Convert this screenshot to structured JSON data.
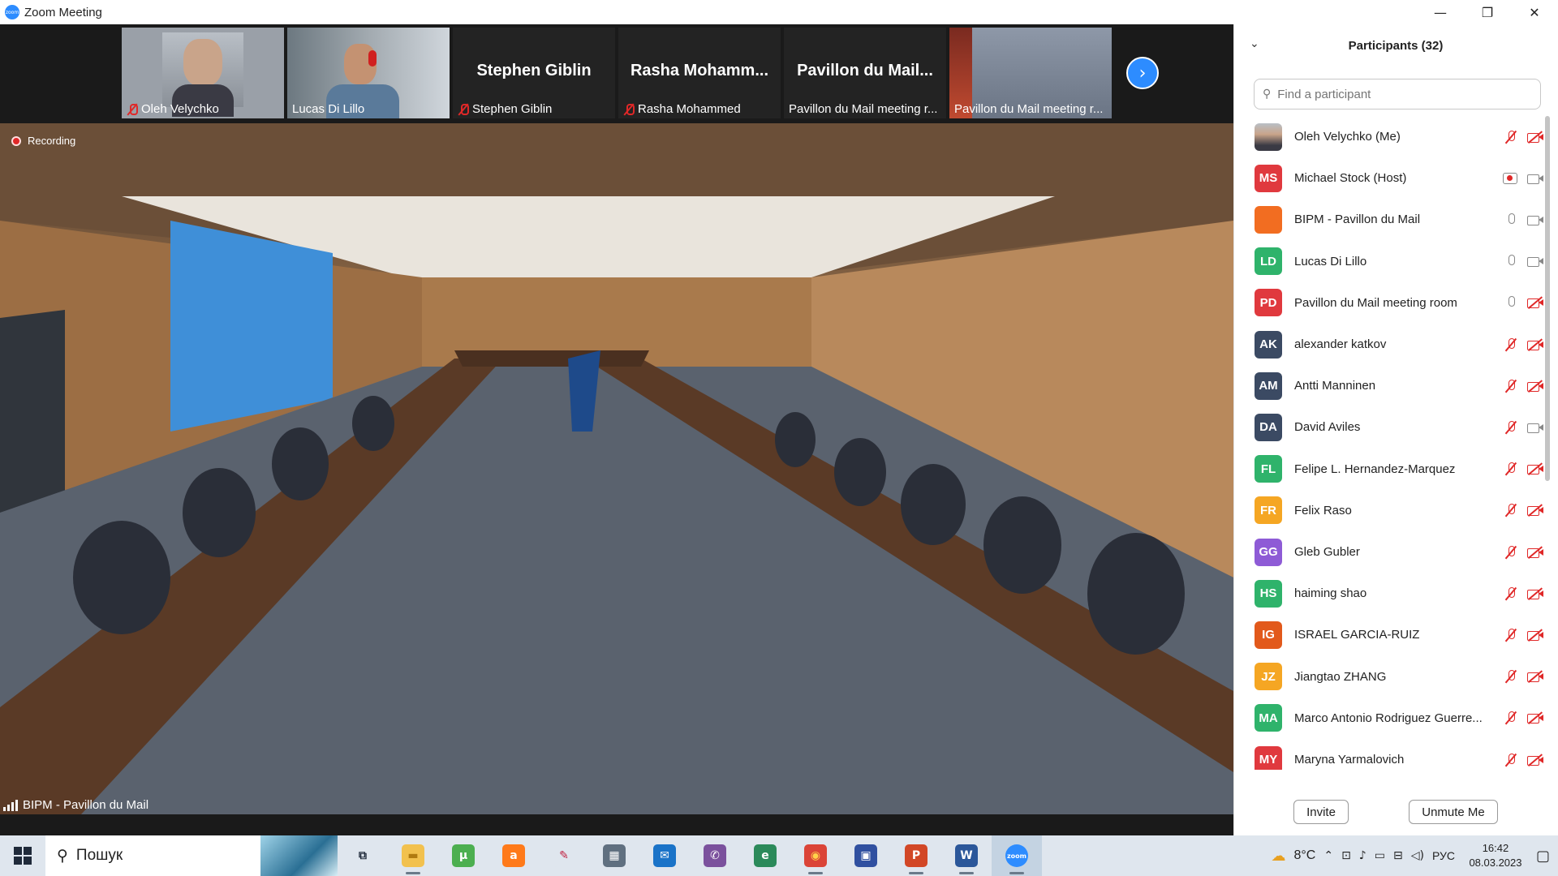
{
  "window": {
    "title": "Zoom Meeting",
    "logo_text": "zoom",
    "minimize": "—",
    "restore": "❐",
    "close": "✕"
  },
  "thumbnails": [
    {
      "name": "Oleh Velychko",
      "muted": true,
      "video": true
    },
    {
      "name": "Lucas Di Lillo",
      "muted": false,
      "video": true
    },
    {
      "name": "Stephen Giblin",
      "display": "Stephen Giblin",
      "muted": true,
      "video": false
    },
    {
      "name": "Rasha Mohammed",
      "display": "Rasha Mohamm...",
      "muted": true,
      "video": false
    },
    {
      "name": "Pavillon du Mail meeting r...",
      "display": "Pavillon du Mail...",
      "muted": false,
      "video": false
    },
    {
      "name": "Pavillon du Mail meeting r...",
      "muted": false,
      "video": true
    }
  ],
  "main_video": {
    "recording_label": "Recording",
    "speaker": "BIPM - Pavillon du Mail"
  },
  "panel": {
    "title": "Participants (32)",
    "search_placeholder": "Find a participant",
    "invite": "Invite",
    "unmute": "Unmute Me",
    "participants": [
      {
        "initials": "",
        "name": "Oleh Velychko (Me)",
        "color": "#7a6a5a",
        "photo": true,
        "mic": "off",
        "cam": "off"
      },
      {
        "initials": "MS",
        "name": "Michael Stock (Host)",
        "color": "#e0393e",
        "mic": "rec",
        "cam": "on"
      },
      {
        "initials": "",
        "name": "BIPM - Pavillon du Mail",
        "color": "#f26d21",
        "room": true,
        "mic": "on",
        "cam": "on"
      },
      {
        "initials": "LD",
        "name": "Lucas Di Lillo",
        "color": "#2fb36b",
        "mic": "on",
        "cam": "on"
      },
      {
        "initials": "PD",
        "name": "Pavillon du Mail meeting room",
        "color": "#e0393e",
        "mic": "on",
        "cam": "off"
      },
      {
        "initials": "AK",
        "name": "alexander katkov",
        "color": "#3b4a63",
        "mic": "off",
        "cam": "off"
      },
      {
        "initials": "AM",
        "name": "Antti Manninen",
        "color": "#3b4a63",
        "mic": "off",
        "cam": "off"
      },
      {
        "initials": "DA",
        "name": "David Aviles",
        "color": "#3b4a63",
        "mic": "off",
        "cam": "on"
      },
      {
        "initials": "FL",
        "name": "Felipe L. Hernandez-Marquez",
        "color": "#2fb36b",
        "mic": "off",
        "cam": "off"
      },
      {
        "initials": "FR",
        "name": "Felix Raso",
        "color": "#f5a623",
        "mic": "off",
        "cam": "off"
      },
      {
        "initials": "GG",
        "name": "Gleb Gubler",
        "color": "#8e5bd6",
        "mic": "off",
        "cam": "off"
      },
      {
        "initials": "HS",
        "name": "haiming shao",
        "color": "#2fb36b",
        "mic": "off",
        "cam": "off"
      },
      {
        "initials": "IG",
        "name": "ISRAEL GARCIA-RUIZ",
        "color": "#e2591b",
        "mic": "off",
        "cam": "off"
      },
      {
        "initials": "JZ",
        "name": "Jiangtao ZHANG",
        "color": "#f5a623",
        "mic": "off",
        "cam": "off"
      },
      {
        "initials": "MA",
        "name": "Marco Antonio Rodriguez Guerre...",
        "color": "#2fb36b",
        "mic": "off",
        "cam": "off"
      },
      {
        "initials": "MY",
        "name": "Maryna Yarmalovich",
        "color": "#e0393e",
        "mic": "off",
        "cam": "off"
      }
    ]
  },
  "taskbar": {
    "search_text": "Пошук",
    "weather": "8°C",
    "lang": "РУС",
    "time": "16:42",
    "date": "08.03.2023",
    "apps": [
      {
        "name": "task-view",
        "color": "#dfe6ee",
        "glyph": "⧉",
        "fg": "#1f2a3a"
      },
      {
        "name": "file-explorer",
        "color": "#f2c14e",
        "glyph": "▬",
        "fg": "#b07a10"
      },
      {
        "name": "utorrent",
        "color": "#4caf50",
        "glyph": "μ",
        "fg": "#fff"
      },
      {
        "name": "avast",
        "color": "#ff7a1a",
        "glyph": "a",
        "fg": "#fff"
      },
      {
        "name": "paint",
        "color": "#dfe6ee",
        "glyph": "✎",
        "fg": "#c02040"
      },
      {
        "name": "calculator",
        "color": "#607080",
        "glyph": "▦",
        "fg": "#fff"
      },
      {
        "name": "mail",
        "color": "#1a73c8",
        "glyph": "✉",
        "fg": "#fff"
      },
      {
        "name": "viber",
        "color": "#7b519d",
        "glyph": "✆",
        "fg": "#fff"
      },
      {
        "name": "edge",
        "color": "#2b8a5a",
        "glyph": "e",
        "fg": "#fff"
      },
      {
        "name": "chrome",
        "color": "#db4437",
        "glyph": "◉",
        "fg": "#ffd24a"
      },
      {
        "name": "save-disk",
        "color": "#3050a0",
        "glyph": "▣",
        "fg": "#fff"
      },
      {
        "name": "powerpoint",
        "color": "#d24726",
        "glyph": "P",
        "fg": "#fff"
      },
      {
        "name": "word",
        "color": "#2b579a",
        "glyph": "W",
        "fg": "#fff"
      },
      {
        "name": "zoom",
        "color": "#2d8cff",
        "glyph": "zoom",
        "fg": "#fff"
      }
    ]
  }
}
